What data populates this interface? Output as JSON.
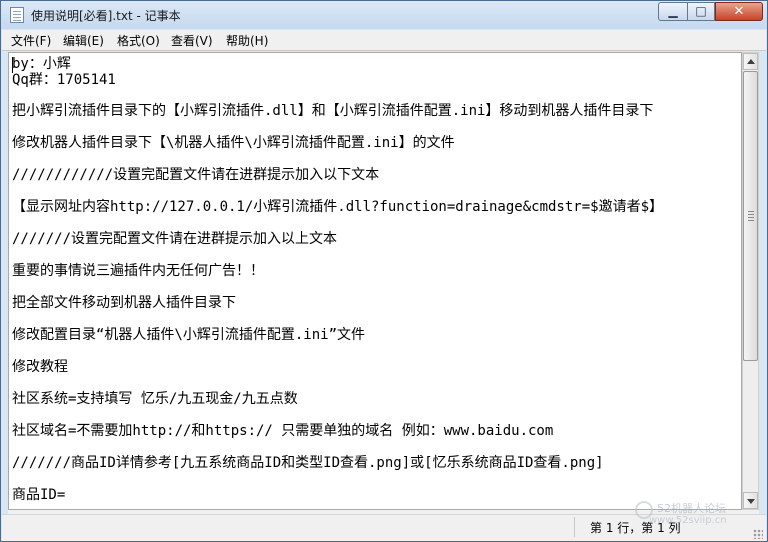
{
  "window": {
    "title": "使用说明[必看].txt - 记事本",
    "controls": {
      "minimize": "▁",
      "maximize": "□",
      "close": "✕"
    }
  },
  "menu": {
    "items": [
      "文件(F)",
      "编辑(E)",
      "格式(O)",
      "查看(V)",
      "帮助(H)"
    ]
  },
  "editor": {
    "lines": [
      "by：小辉",
      "Qq群：1705141",
      "把小辉引流插件目录下的【小辉引流插件.dll】和【小辉引流插件配置.ini】移动到机器人插件目录下",
      "修改机器人插件目录下【\\机器人插件\\小辉引流插件配置.ini】的文件",
      "////////////设置完配置文件请在进群提示加入以下文本",
      "【显示网址内容http://127.0.0.1/小辉引流插件.dll?function=drainage&cmdstr=$邀请者$】",
      "///////设置完配置文件请在进群提示加入以上文本",
      "重要的事情说三遍插件内无任何广告！！",
      "把全部文件移动到机器人插件目录下",
      "修改配置目录“机器人插件\\小辉引流插件配置.ini”文件",
      "修改教程",
      "社区系统=支持填写 忆乐/九五现金/九五点数",
      "社区域名=不需要加http://和https:// 只需要单独的域名 例如：www.baidu.com",
      "///////商品ID详情参考[九五系统商品ID和类型ID查看.png]或[忆乐系统商品ID查看.png]",
      "商品ID="
    ]
  },
  "status": {
    "position": "第 1 行，第 1 列"
  },
  "watermark": {
    "line1": "52机器人论坛",
    "line2": "www.52sviip.cn"
  }
}
